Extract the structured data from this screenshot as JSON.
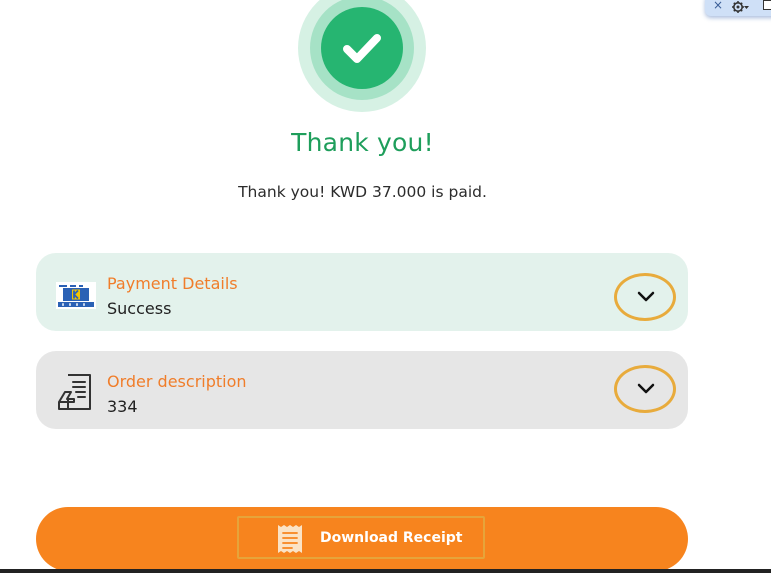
{
  "status": {
    "title": "Thank you!",
    "message": "Thank you! KWD 37.000 is paid."
  },
  "payment_card": {
    "label": "Payment Details",
    "value": "Success",
    "icon": "knet-logo-icon"
  },
  "order_card": {
    "label": "Order description",
    "value": "334",
    "icon": "invoice-icon"
  },
  "receipt": {
    "label": "Download Receipt",
    "icon": "receipt-icon"
  },
  "toolbar": {
    "close_glyph": "×"
  },
  "colors": {
    "accent_green": "#26b571",
    "title_green": "#1e9e5b",
    "accent_orange": "#f7841e",
    "label_orange": "#f07d2a",
    "chevron_ring": "#e8ab3c",
    "payment_card_bg": "#e3f2ec",
    "order_card_bg": "#e6e6e6"
  }
}
